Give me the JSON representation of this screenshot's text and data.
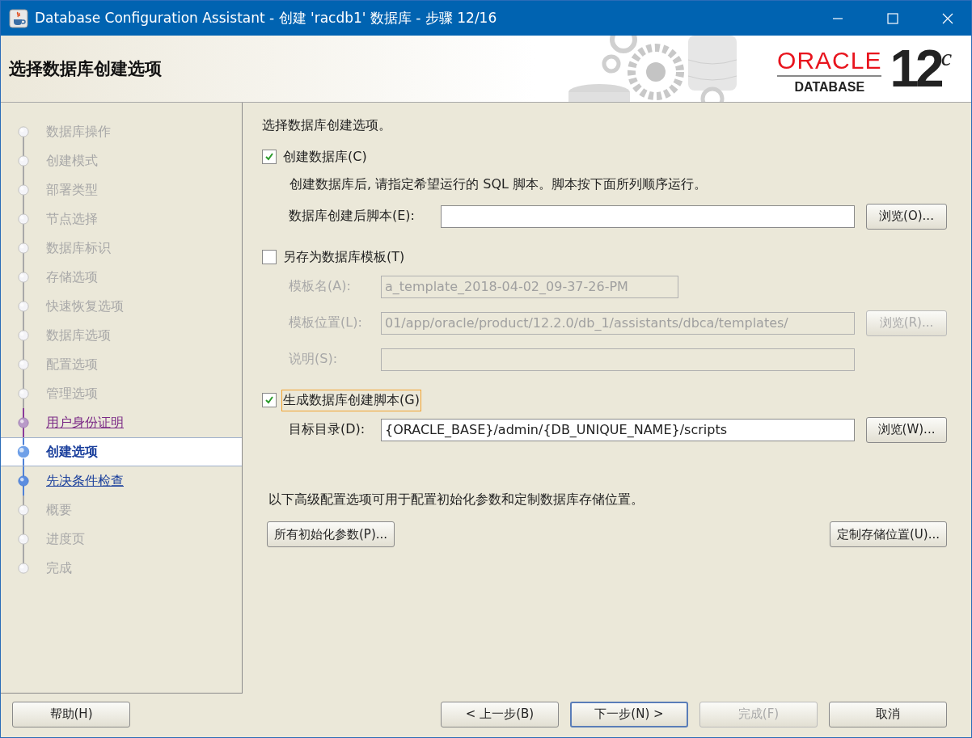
{
  "window": {
    "title": "Database Configuration Assistant - 创建 'racdb1' 数据库 - 步骤 12/16"
  },
  "banner": {
    "title": "选择数据库创建选项",
    "logo_brand": "ORACLE",
    "logo_product": "DATABASE",
    "logo_version": "12",
    "logo_suffix": "c"
  },
  "sidebar": {
    "items": [
      {
        "label": "数据库操作",
        "kind": "pending",
        "selected": false
      },
      {
        "label": "创建模式",
        "kind": "pending",
        "selected": false
      },
      {
        "label": "部署类型",
        "kind": "pending",
        "selected": false
      },
      {
        "label": "节点选择",
        "kind": "pending",
        "selected": false
      },
      {
        "label": "数据库标识",
        "kind": "pending",
        "selected": false
      },
      {
        "label": "存储选项",
        "kind": "pending",
        "selected": false
      },
      {
        "label": "快速恢复选项",
        "kind": "pending",
        "selected": false
      },
      {
        "label": "数据库选项",
        "kind": "pending",
        "selected": false
      },
      {
        "label": "配置选项",
        "kind": "pending",
        "selected": false
      },
      {
        "label": "管理选项",
        "kind": "pending",
        "selected": false
      },
      {
        "label": "用户身份证明",
        "kind": "visited",
        "selected": false
      },
      {
        "label": "创建选项",
        "kind": "current",
        "selected": true
      },
      {
        "label": "先决条件检查",
        "kind": "link",
        "selected": false
      },
      {
        "label": "概要",
        "kind": "pending",
        "selected": false
      },
      {
        "label": "进度页",
        "kind": "pending",
        "selected": false
      },
      {
        "label": "完成",
        "kind": "pending",
        "selected": false
      }
    ]
  },
  "content": {
    "intro": "选择数据库创建选项。",
    "options": [
      {
        "label": "创建数据库(C)",
        "checked": true,
        "focused": false,
        "description": "创建数据库后, 请指定希望运行的 SQL 脚本。脚本按下面所列顺序运行。",
        "fields": [
          {
            "label": "数据库创建后脚本(E):",
            "kind": "long",
            "disabled": false,
            "button": "浏览(O)..."
          }
        ]
      },
      {
        "label": "另存为数据库模板(T)",
        "checked": false,
        "focused": false,
        "fields": [
          {
            "label": "模板名(A):",
            "value": "a_template_2018-04-02_09-37-26-PM",
            "kind": "short",
            "disabled": true
          },
          {
            "label": "模板位置(L):",
            "value": "01/app/oracle/product/12.2.0/db_1/assistants/dbca/templates/",
            "kind": "long",
            "disabled": true,
            "button": "浏览(R)..."
          },
          {
            "label": "说明(S):",
            "kind": "long",
            "disabled": true
          }
        ]
      },
      {
        "label": "生成数据库创建脚本(G)",
        "checked": true,
        "focused": true,
        "fields": [
          {
            "label": "目标目录(D):",
            "value": "{ORACLE_BASE}/admin/{DB_UNIQUE_NAME}/scripts",
            "kind": "long",
            "disabled": false,
            "button": "浏览(W)..."
          }
        ]
      }
    ],
    "advanced_note": "以下高级配置选项可用于配置初始化参数和定制数据库存储位置。",
    "advanced_buttons": [
      "所有初始化参数(P)...",
      "定制存储位置(U)..."
    ]
  },
  "footer": {
    "help": "帮助(H)",
    "buttons": [
      {
        "label": "< 上一步(B)",
        "disabled": false,
        "default": false
      },
      {
        "label": "下一步(N) >",
        "disabled": false,
        "default": true
      },
      {
        "label": "完成(F)",
        "disabled": true,
        "default": false
      },
      {
        "label": "取消",
        "disabled": false,
        "default": false
      }
    ]
  }
}
